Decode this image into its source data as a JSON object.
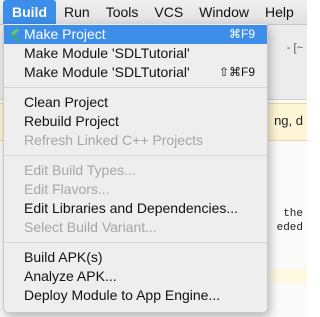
{
  "menubar": {
    "items": [
      "Build",
      "Run",
      "Tools",
      "VCS",
      "Window",
      "Help"
    ]
  },
  "background": {
    "path_fragment": "- [~",
    "notice_fragment": "ng, d",
    "code_line_1": "the",
    "code_line_2": "eded"
  },
  "dropdown": {
    "make_project": "Make Project",
    "make_project_shortcut": "⌘F9",
    "make_module_1": "Make Module 'SDLTutorial'",
    "make_module_2": "Make Module 'SDLTutorial'",
    "make_module_2_shortcut": "⇧⌘F9",
    "clean_project": "Clean Project",
    "rebuild_project": "Rebuild Project",
    "refresh_cpp": "Refresh Linked C++ Projects",
    "edit_build_types": "Edit Build Types...",
    "edit_flavors": "Edit Flavors...",
    "edit_libraries": "Edit Libraries and Dependencies...",
    "select_build_variant": "Select Build Variant...",
    "build_apk": "Build APK(s)",
    "analyze_apk": "Analyze APK...",
    "deploy_module": "Deploy Module to App Engine..."
  },
  "icons": {
    "make_project_icon": "hammer-icon"
  },
  "colors": {
    "highlight": "#3d8ee8",
    "menu_background": "#eeeeee",
    "disabled_text": "#a6a6a6",
    "hammer_icon": "#4caf50"
  }
}
